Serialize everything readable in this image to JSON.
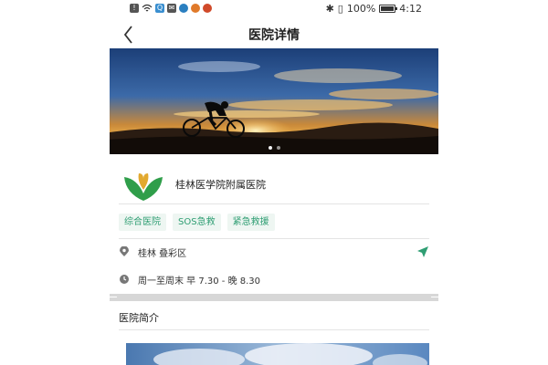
{
  "status_bar": {
    "battery": "100%",
    "time": "4:12"
  },
  "header": {
    "title": "医院详情"
  },
  "banner": {
    "slide_count": 2,
    "active_slide": 1
  },
  "hospital": {
    "name": "桂林医学院附属医院",
    "logo_colors": {
      "leaf": "#2f9e4a",
      "heart": "#e2a92f"
    }
  },
  "tags": [
    {
      "label": "综合医院"
    },
    {
      "label": "SOS急救"
    },
    {
      "label": "紧急救援"
    }
  ],
  "address": {
    "text": "桂林 叠彩区"
  },
  "hours": {
    "text": "周一至周末 早 7.30 - 晚 8.30"
  },
  "intro": {
    "title": "医院简介"
  },
  "colors": {
    "accent": "#2f9e73",
    "tag_bg": "#eef6f2"
  }
}
